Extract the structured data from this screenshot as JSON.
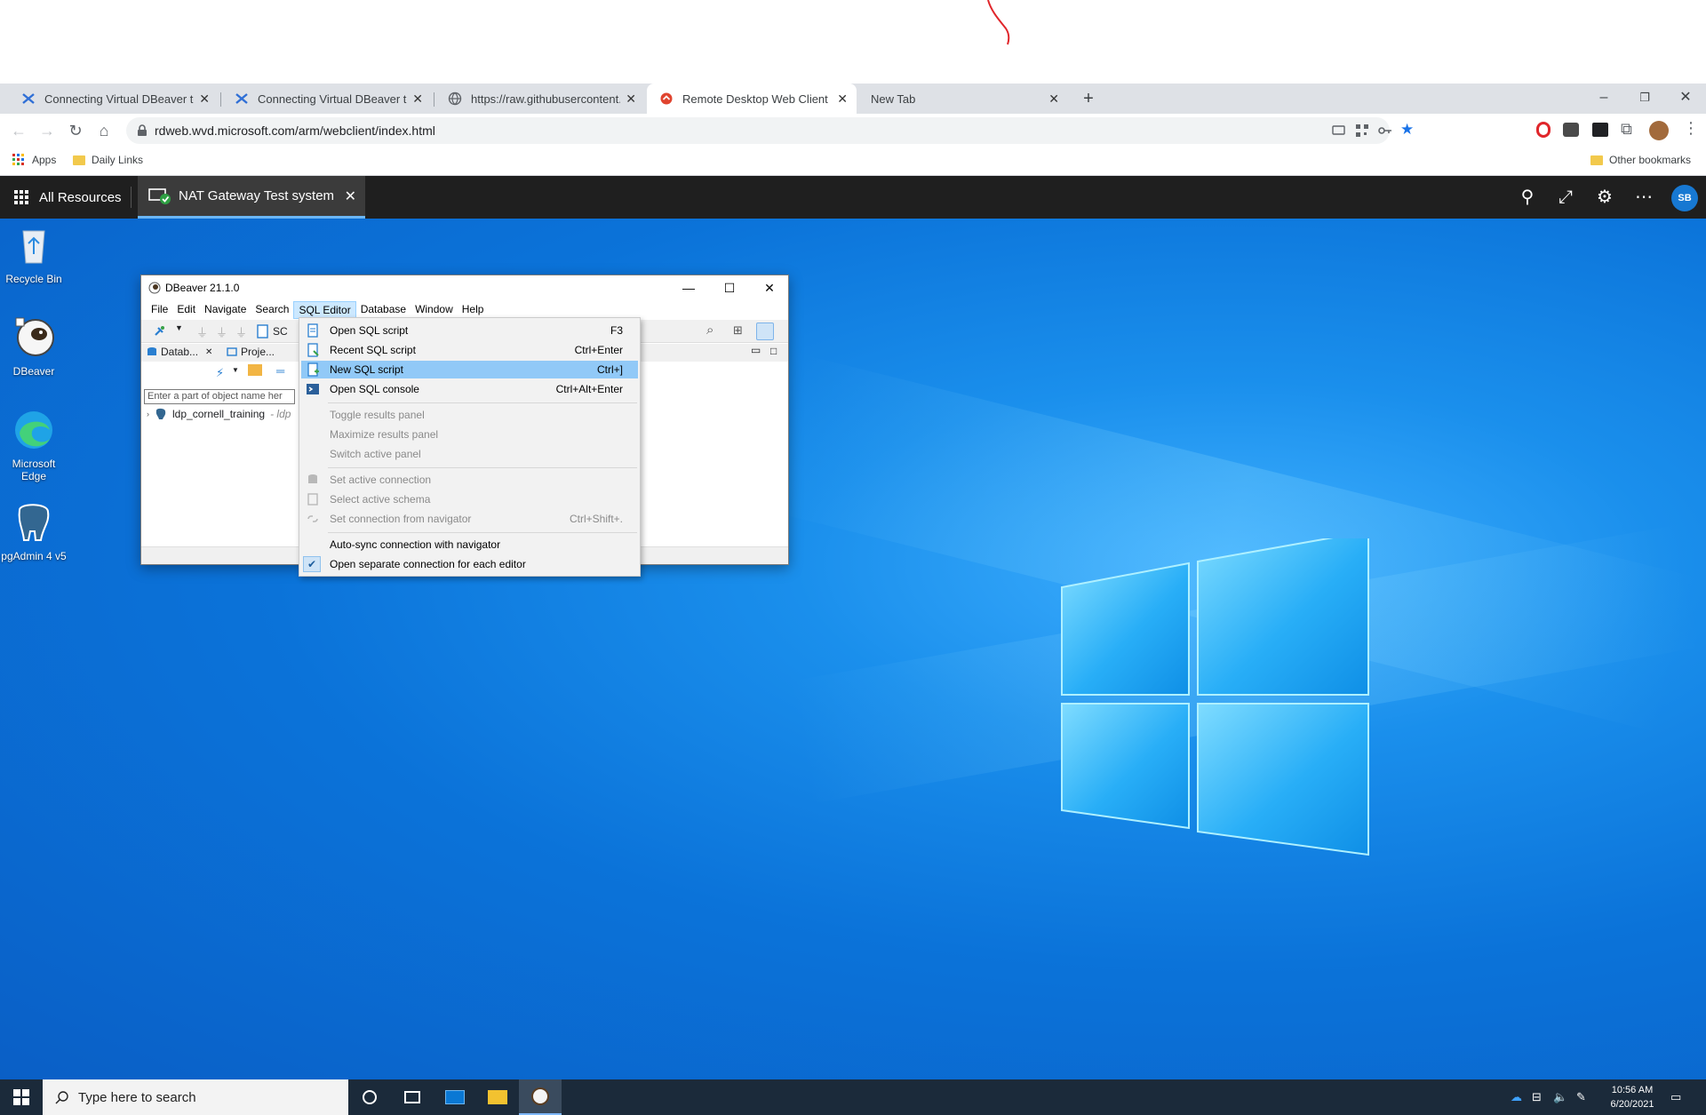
{
  "browser": {
    "tabs": [
      {
        "title": "Connecting Virtual DBeaver to th",
        "favicon": "dbeaver-icon"
      },
      {
        "title": "Connecting Virtual DBeaver to th",
        "favicon": "dbeaver-icon"
      },
      {
        "title": "https://raw.githubusercontent.co",
        "favicon": "globe-icon"
      },
      {
        "title": "Remote Desktop Web Client",
        "favicon": "remote-desktop-icon"
      },
      {
        "title": "New Tab",
        "favicon": ""
      }
    ],
    "active_tab": 3,
    "url": "rdweb.wvd.microsoft.com/arm/webclient/index.html",
    "bookmarks": {
      "apps": "Apps",
      "daily_links": "Daily Links",
      "other": "Other bookmarks"
    },
    "accent_color": "#1a73e8"
  },
  "rdclient": {
    "all_resources": "All Resources",
    "session_tab": "NAT Gateway Test system",
    "user_initials": "SB"
  },
  "desktop": {
    "icons": [
      {
        "label": "Recycle Bin"
      },
      {
        "label": "DBeaver"
      },
      {
        "label": "Microsoft Edge"
      },
      {
        "label": "pgAdmin 4 v5"
      }
    ]
  },
  "dbeaver": {
    "title": "DBeaver 21.1.0",
    "menus": [
      "File",
      "Edit",
      "Navigate",
      "Search",
      "SQL Editor",
      "Database",
      "Window",
      "Help"
    ],
    "open_menu": "SQL Editor",
    "panel_tabs": [
      "Datab...",
      "Proje..."
    ],
    "toolbar_partial": "SC",
    "filter_placeholder": "Enter a part of object name her",
    "tree": {
      "name": "ldp_cornell_training",
      "suffix": "- ldp"
    }
  },
  "sql_menu": {
    "items": [
      {
        "label": "Open SQL script",
        "shortcut": "F3",
        "enabled": true
      },
      {
        "label": "Recent SQL script",
        "shortcut": "Ctrl+Enter",
        "enabled": true
      },
      {
        "label": "New SQL script",
        "shortcut": "Ctrl+]",
        "enabled": true,
        "highlighted": true
      },
      {
        "label": "Open SQL console",
        "shortcut": "Ctrl+Alt+Enter",
        "enabled": true
      },
      {
        "label": "Toggle results panel",
        "shortcut": "",
        "enabled": false
      },
      {
        "label": "Maximize results panel",
        "shortcut": "",
        "enabled": false
      },
      {
        "label": "Switch active panel",
        "shortcut": "",
        "enabled": false
      },
      {
        "label": "Set active connection",
        "shortcut": "",
        "enabled": false
      },
      {
        "label": "Select active schema",
        "shortcut": "",
        "enabled": false
      },
      {
        "label": "Set connection from navigator",
        "shortcut": "Ctrl+Shift+.",
        "enabled": false
      },
      {
        "label": "Auto-sync connection with navigator",
        "shortcut": "",
        "enabled": true
      },
      {
        "label": "Open separate connection for each editor",
        "shortcut": "",
        "enabled": true,
        "checked": true
      }
    ]
  },
  "taskbar": {
    "search_placeholder": "Type here to search",
    "time": "10:56 AM",
    "date": "6/20/2021"
  }
}
